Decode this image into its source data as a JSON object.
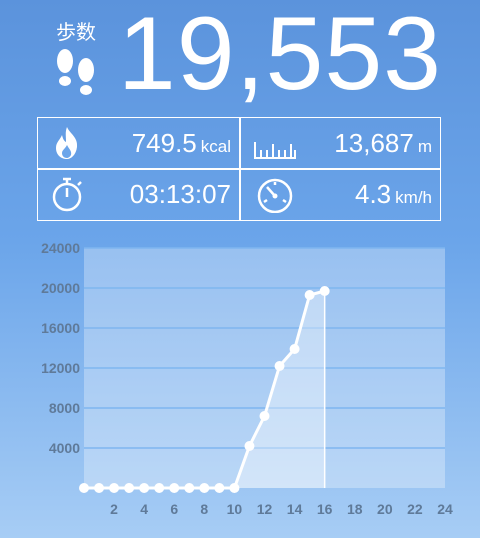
{
  "header": {
    "steps_label": "歩数",
    "steps_value": "19,553"
  },
  "stats": {
    "calories": {
      "value": "749.5",
      "unit": "kcal",
      "icon": "flame-icon"
    },
    "distance": {
      "value": "13,687",
      "unit": "m",
      "icon": "ruler-icon"
    },
    "duration": {
      "value": "03:13:07",
      "icon": "stopwatch-icon"
    },
    "speed": {
      "value": "4.3",
      "unit": "km/h",
      "icon": "speedometer-icon"
    }
  },
  "chart_data": {
    "type": "area",
    "x": [
      0,
      1,
      2,
      3,
      4,
      5,
      6,
      7,
      8,
      9,
      10,
      11,
      12,
      13,
      14,
      15,
      16
    ],
    "values": [
      0,
      0,
      0,
      0,
      0,
      0,
      0,
      0,
      0,
      0,
      0,
      4200,
      7200,
      12200,
      13900,
      19300,
      19700
    ],
    "x_ticks": [
      "2",
      "4",
      "6",
      "8",
      "10",
      "12",
      "14",
      "16",
      "18",
      "20",
      "22",
      "24"
    ],
    "y_ticks": [
      "4000",
      "8000",
      "12000",
      "16000",
      "20000",
      "24000"
    ],
    "xlim": [
      0,
      24
    ],
    "ylim": [
      0,
      24000
    ],
    "grid": true,
    "colors": {
      "line": "#ffffff",
      "fill": "rgba(255,255,255,0.35)",
      "plot_bg": "rgba(255,255,255,0.30)",
      "grid": "#7fb6f0"
    }
  }
}
